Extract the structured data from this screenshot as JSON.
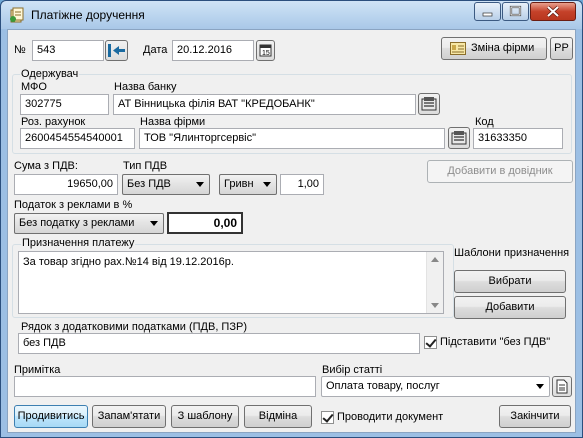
{
  "window": {
    "title": "Платіжне доручення"
  },
  "header": {
    "number_label": "№",
    "number_value": "543",
    "date_label": "Дата",
    "date_value": "20.12.2016",
    "change_firm_label": "Зміна фірми",
    "pp_label": "PP"
  },
  "recipient": {
    "group_label": "Одержувач",
    "mfo_label": "МФО",
    "mfo_value": "302775",
    "bank_label": "Назва банку",
    "bank_value": "АТ Вінницька філія ВАТ \"КРЕДОБАНК\"",
    "account_label": "Роз. рахунок",
    "account_value": "2600454554540001",
    "firm_label": "Назва фірми",
    "firm_value": "ТОВ \"Ялинторгсервіс\"",
    "code_label": "Код",
    "code_value": "31633350"
  },
  "amount": {
    "sum_label": "Сума з ПДВ:",
    "sum_value": "19650,00",
    "vat_type_label": "Тип ПДВ",
    "vat_type_value": "Без ПДВ",
    "currency_value": "Гривн",
    "rate_value": "1,00",
    "add_directory_label": "Добавити в довідник",
    "ad_tax_label": "Податок з реклами в %",
    "ad_tax_value": "Без податку з реклами",
    "ad_tax_amount": "0,00"
  },
  "purpose": {
    "label": "Призначення платежу",
    "text": "За товар згідно рах.№14 від 19.12.2016р.",
    "templates_label": "Шаблони призначення",
    "choose_label": "Вибрати",
    "add_label": "Добавити"
  },
  "extra_tax": {
    "label": "Рядок з додатковими податками (ПДВ, ПЗР)",
    "value": "без ПДВ",
    "substitute_label": "Підставити \"без ПДВ\""
  },
  "note": {
    "label": "Примітка",
    "value": ""
  },
  "article": {
    "label": "Вибір статті",
    "value": "Оплата товару, послуг"
  },
  "footer": {
    "continue_label": "Продивитись",
    "remember_label": "Запам'ятати",
    "from_template_label": "З шаблону",
    "cancel_label": "Відміна",
    "post_label": "Проводити документ",
    "finish_label": "Закінчити"
  }
}
